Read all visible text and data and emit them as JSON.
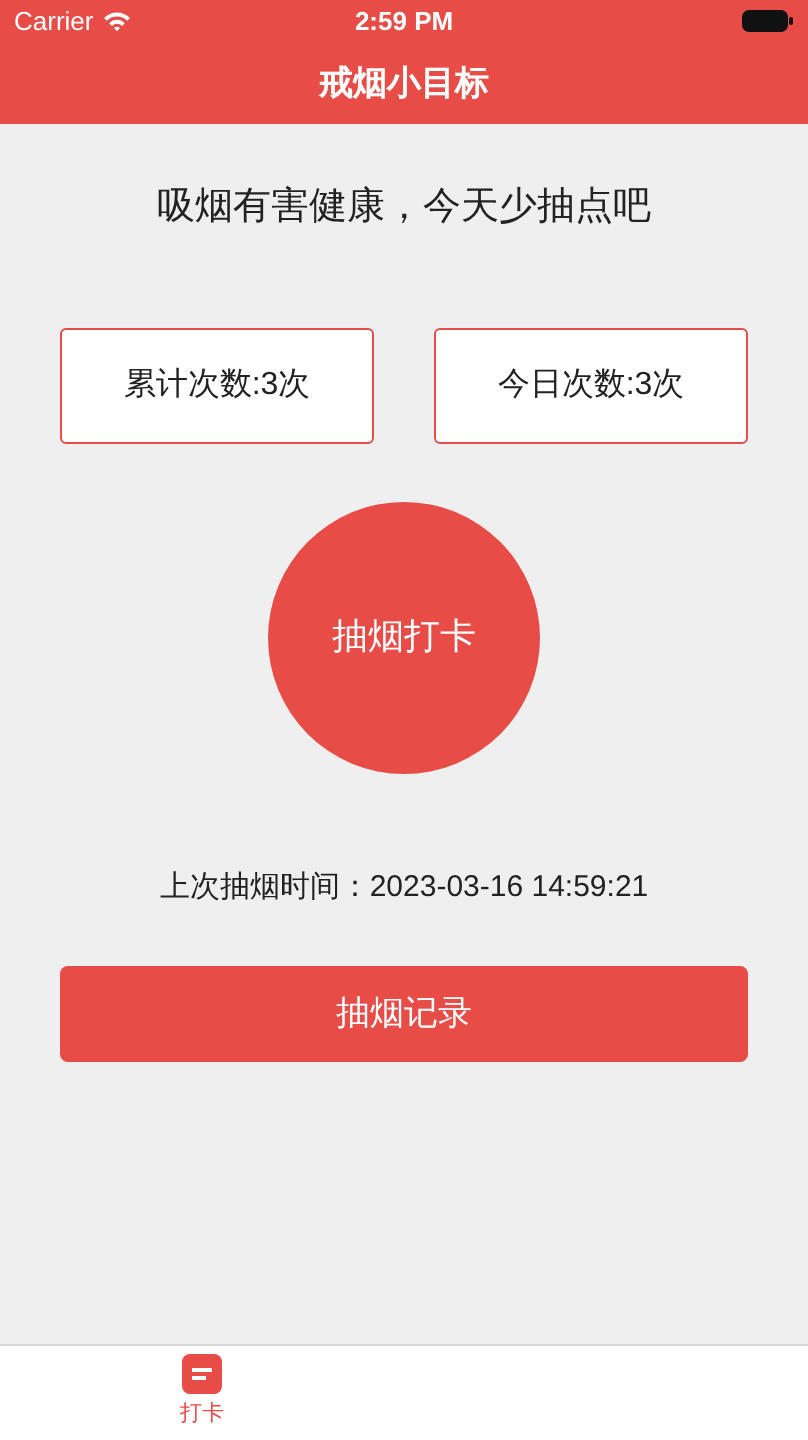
{
  "status_bar": {
    "carrier": "Carrier",
    "time": "2:59 PM"
  },
  "nav": {
    "title": "戒烟小目标"
  },
  "headline": "吸烟有害健康，今天少抽点吧",
  "counters": [
    {
      "label": "累计次数:3次"
    },
    {
      "label": "今日次数:3次"
    }
  ],
  "checkin_button": "抽烟打卡",
  "last_time": "上次抽烟时间：2023-03-16 14:59:21",
  "records_button": "抽烟记录",
  "tabs": [
    {
      "label": "打卡",
      "selected": true
    }
  ]
}
